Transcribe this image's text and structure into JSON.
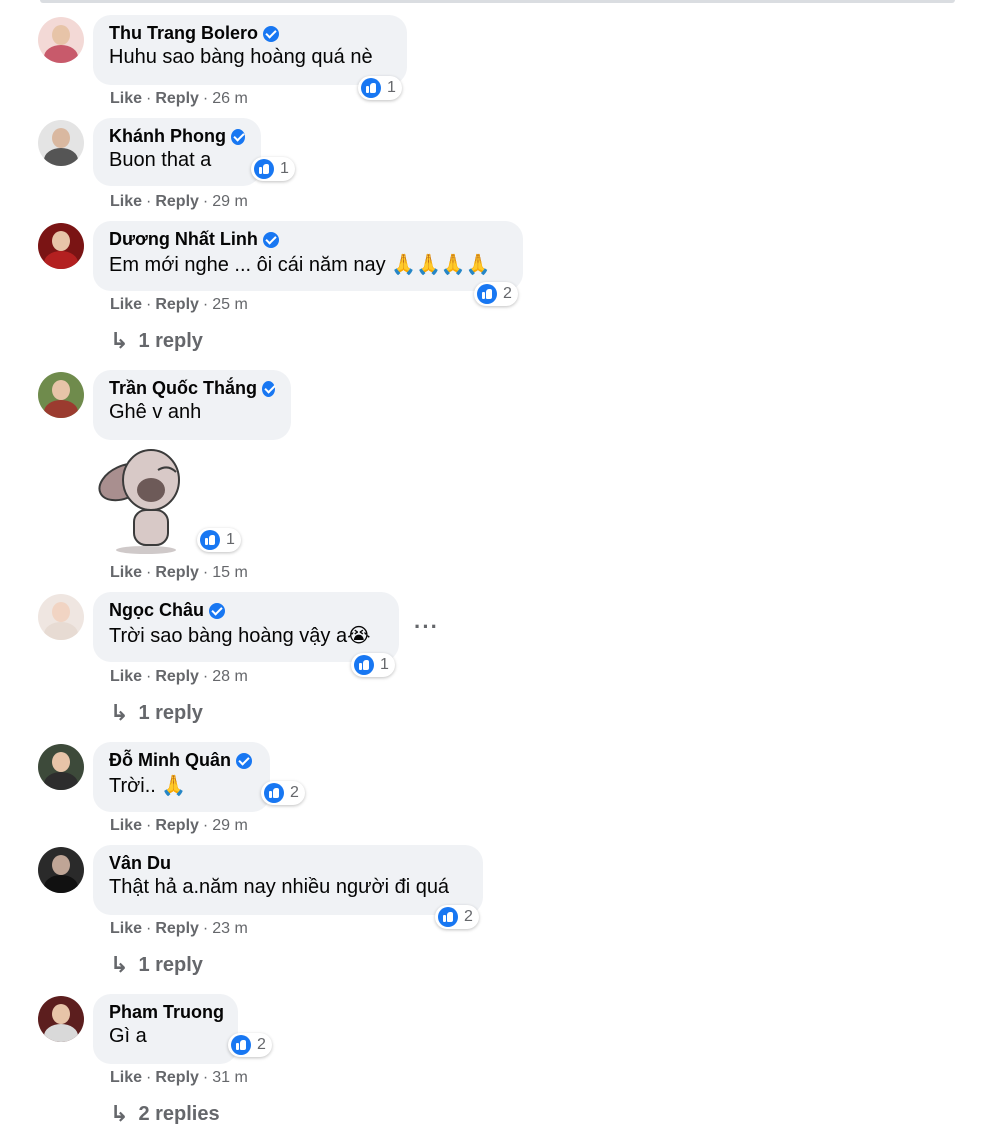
{
  "comments": [
    {
      "author": "Thu Trang Bolero",
      "verified": true,
      "text": "Huhu sao bàng hoàng quá nè",
      "likes": "1",
      "like": "Like",
      "reply": "Reply",
      "time": "26 m"
    },
    {
      "author": "Khánh Phong",
      "verified": true,
      "text": "Buon that a",
      "likes": "1",
      "like": "Like",
      "reply": "Reply",
      "time": "29 m"
    },
    {
      "author": "Dương Nhất Linh",
      "verified": true,
      "text": "Em mới nghe ... ôi cái năm nay 🙏🙏🙏🙏",
      "likes": "2",
      "like": "Like",
      "reply": "Reply",
      "time": "25 m",
      "replies": "1 reply"
    },
    {
      "author": "Trần Quốc Thắng",
      "verified": true,
      "text": "Ghê v anh",
      "likes": "1",
      "like": "Like",
      "reply": "Reply",
      "time": "15 m"
    },
    {
      "author": "Ngọc Châu",
      "verified": true,
      "text": "Trời sao bàng hoàng vậy a😭",
      "likes": "1",
      "like": "Like",
      "reply": "Reply",
      "time": "28 m",
      "replies": "1 reply"
    },
    {
      "author": "Đỗ Minh Quân",
      "verified": true,
      "text": "Trời.. 🙏",
      "likes": "2",
      "like": "Like",
      "reply": "Reply",
      "time": "29 m"
    },
    {
      "author": "Vân Du",
      "verified": false,
      "text": "Thật hả a.năm nay nhiều người đi quá",
      "likes": "2",
      "like": "Like",
      "reply": "Reply",
      "time": "23 m",
      "replies": "1 reply"
    },
    {
      "author": "Pham Truong",
      "verified": false,
      "text": "Gì a",
      "likes": "2",
      "like": "Like",
      "reply": "Reply",
      "time": "31 m",
      "replies": "2 replies"
    }
  ],
  "icons": {
    "verified": "verified-badge-icon",
    "like": "like-thumb-icon",
    "reply_arrow": "reply-arrow-icon",
    "more": "more-options-icon"
  },
  "colors": {
    "accent": "#1877f2",
    "bubble": "#f0f2f5",
    "meta": "#65676b"
  }
}
